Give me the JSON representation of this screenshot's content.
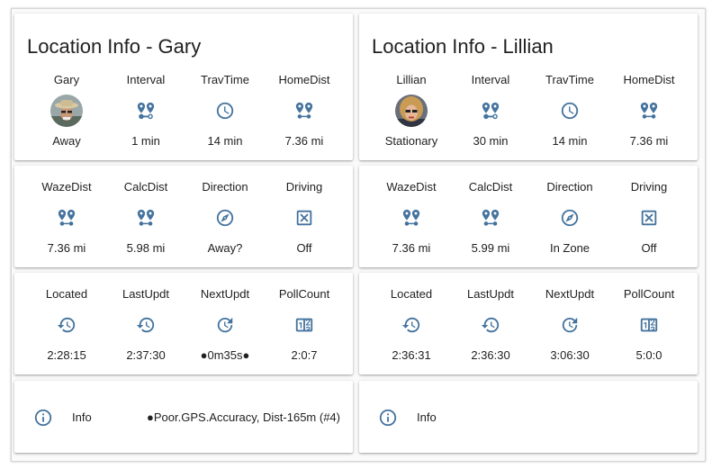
{
  "colors": {
    "icon": "#44739e"
  },
  "gary": {
    "title": "Location Info - Gary",
    "row1": [
      {
        "label": "Gary",
        "value": "Away",
        "icon": "avatar-gary"
      },
      {
        "label": "Interval",
        "value": "1 min",
        "icon": "map-marker-distance-icon"
      },
      {
        "label": "TravTime",
        "value": "14 min",
        "icon": "clock-icon"
      },
      {
        "label": "HomeDist",
        "value": "7.36 mi",
        "icon": "map-marker-multiple-icon"
      }
    ],
    "row2": [
      {
        "label": "WazeDist",
        "value": "7.36 mi",
        "icon": "map-marker-multiple-icon"
      },
      {
        "label": "CalcDist",
        "value": "5.98 mi",
        "icon": "map-marker-multiple-icon"
      },
      {
        "label": "Direction",
        "value": "Away?",
        "icon": "compass-icon"
      },
      {
        "label": "Driving",
        "value": "Off",
        "icon": "close-box-icon"
      }
    ],
    "row3": [
      {
        "label": "Located",
        "value": "2:28:15",
        "icon": "history-icon"
      },
      {
        "label": "LastUpdt",
        "value": "2:37:30",
        "icon": "history-icon"
      },
      {
        "label": "NextUpdt",
        "value": "●0m35s●",
        "icon": "update-icon"
      },
      {
        "label": "PollCount",
        "value": "2:0:7",
        "icon": "counter-icon"
      }
    ],
    "info": {
      "label": "Info",
      "value": "●Poor.GPS.Accuracy, Dist-165m (#4)"
    }
  },
  "lillian": {
    "title": "Location Info - Lillian",
    "row1": [
      {
        "label": "Lillian",
        "value": "Stationary",
        "icon": "avatar-lillian"
      },
      {
        "label": "Interval",
        "value": "30 min",
        "icon": "map-marker-distance-icon"
      },
      {
        "label": "TravTime",
        "value": "14 min",
        "icon": "clock-icon"
      },
      {
        "label": "HomeDist",
        "value": "7.36 mi",
        "icon": "map-marker-multiple-icon"
      }
    ],
    "row2": [
      {
        "label": "WazeDist",
        "value": "7.36 mi",
        "icon": "map-marker-multiple-icon"
      },
      {
        "label": "CalcDist",
        "value": "5.99 mi",
        "icon": "map-marker-multiple-icon"
      },
      {
        "label": "Direction",
        "value": "In Zone",
        "icon": "compass-icon"
      },
      {
        "label": "Driving",
        "value": "Off",
        "icon": "close-box-icon"
      }
    ],
    "row3": [
      {
        "label": "Located",
        "value": "2:36:31",
        "icon": "history-icon"
      },
      {
        "label": "LastUpdt",
        "value": "2:36:30",
        "icon": "history-icon"
      },
      {
        "label": "NextUpdt",
        "value": "3:06:30",
        "icon": "update-icon"
      },
      {
        "label": "PollCount",
        "value": "5:0:0",
        "icon": "counter-icon"
      }
    ],
    "info": {
      "label": "Info",
      "value": ""
    }
  }
}
